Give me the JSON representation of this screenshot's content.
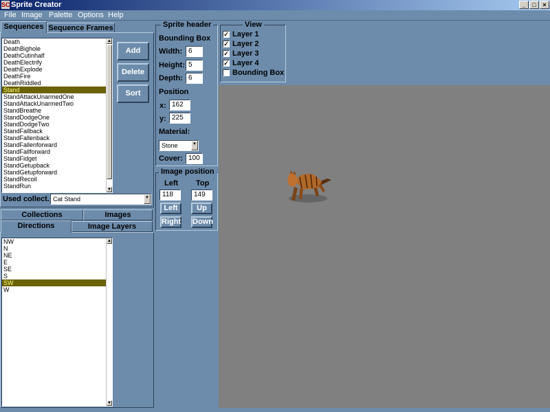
{
  "window": {
    "logo": "SC",
    "title": "Sprite Creator",
    "buttons": [
      "_",
      "□",
      "×"
    ]
  },
  "menu": [
    "File",
    "Image",
    "Palette",
    "Options",
    "Help"
  ],
  "top_tabs": [
    {
      "label": "Sequences",
      "active": true
    },
    {
      "label": "Sequence Frames",
      "active": false
    }
  ],
  "sequences": {
    "items": [
      "Death",
      "DeathBighole",
      "DeathCutinhalf",
      "DeathElectrify",
      "DeathExplode",
      "DeathFire",
      "DeathRiddled",
      "Stand",
      "StandAttackUnarmedOne",
      "StandAttackUnarmedTwo",
      "StandBreathe",
      "StandDodgeOne",
      "StandDodgeTwo",
      "StandFallback",
      "StandFallenback",
      "StandFallenforward",
      "StandFallforward",
      "StandFidget",
      "StandGetupback",
      "StandGetupforward",
      "StandRecoil",
      "StandRun"
    ],
    "selected": "Stand",
    "buttons": {
      "add": "Add",
      "delete": "Delete",
      "sort": "Sort"
    },
    "used_collect_label": "Used collect.:",
    "used_collect_value": "Cat Stand"
  },
  "bottom_tabs_row1": [
    "Collections",
    "Images"
  ],
  "bottom_tabs_row2": [
    {
      "label": "Directions",
      "active": true
    },
    {
      "label": "Image Layers",
      "active": false
    }
  ],
  "directions": {
    "items": [
      "NW",
      "N",
      "NE",
      "E",
      "SE",
      "S",
      "SW",
      "W"
    ],
    "selected": "SW"
  },
  "sprite_header": {
    "title": "Sprite header",
    "bounding_box_label": "Bounding Box",
    "width_label": "Width:",
    "width": "6",
    "height_label": "Height:",
    "height": "5",
    "depth_label": "Depth:",
    "depth": "6",
    "position_label": "Position",
    "x_label": "x:",
    "x": "162",
    "y_label": "y:",
    "y": "225",
    "material_label": "Material:",
    "material": "Stone",
    "cover_label": "Cover:",
    "cover": "100"
  },
  "image_position": {
    "title": "Image position",
    "left_label": "Left",
    "top_label": "Top",
    "left": "118",
    "top": "149",
    "buttons": {
      "left": "Left",
      "up": "Up",
      "right": "Right",
      "down": "Down"
    }
  },
  "view": {
    "title": "View",
    "options": [
      {
        "label": "Layer 1",
        "checked": true
      },
      {
        "label": "Layer 2",
        "checked": true
      },
      {
        "label": "Layer 3",
        "checked": true
      },
      {
        "label": "Layer 4",
        "checked": true
      },
      {
        "label": "Bounding Box",
        "checked": false
      }
    ]
  },
  "colors": {
    "panel": "#6d8cab",
    "viewport": "#808080",
    "selection": "#6b6200",
    "selection_text": "#ffff80"
  }
}
